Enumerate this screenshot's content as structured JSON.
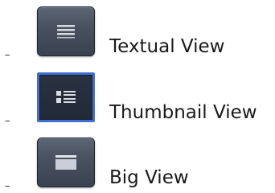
{
  "bullet_symbol": "–",
  "views": [
    {
      "label": "Textual View",
      "icon": "list-lines-icon",
      "active": false
    },
    {
      "label": "Thumbnail View",
      "icon": "thumbnail-list-icon",
      "active": true
    },
    {
      "label": "Big View",
      "icon": "big-panel-icon",
      "active": false
    }
  ],
  "colors": {
    "button_dark": "#3a4150",
    "button_light": "#5d6675",
    "active_border": "#3f6fd0",
    "icon_light": "#d7dbe2",
    "text": "#1a1a1a"
  }
}
